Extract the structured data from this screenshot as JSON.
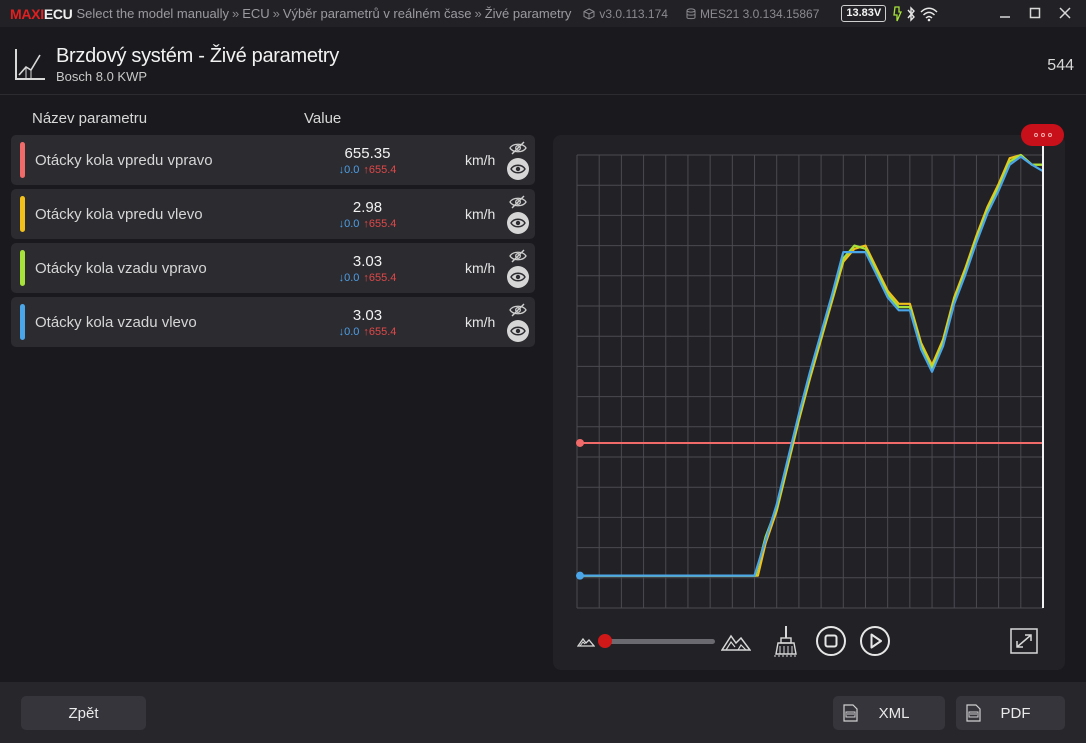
{
  "titlebar": {
    "logo_maxi": "MAXI",
    "logo_ecu": "ECU",
    "breadcrumbs": [
      "Select the model manually",
      "ECU",
      "Výběr parametrů v reálném čase",
      "Živé parametry"
    ],
    "separator": "»",
    "app_version": "v3.0.113.174",
    "device_version": "MES21 3.0.134.15867",
    "voltage": "13.83V",
    "icons": [
      "bolt-icon",
      "bluetooth-icon",
      "wifi-icon"
    ],
    "window_controls": [
      "minimize-icon",
      "maximize-icon",
      "close-icon"
    ]
  },
  "header": {
    "icon": "live-data-chart-icon",
    "title": "Brzdový systém - Živé parametry",
    "subtitle": "Bosch 8.0 KWP",
    "number": "544"
  },
  "params": {
    "col_name": "Název parametru",
    "col_value": "Value",
    "rows": [
      {
        "name": "Otácky kola vpredu vpravo",
        "value": "655.35",
        "min": "↓0.0",
        "max": "↑655.4",
        "unit": "km/h",
        "color": "#f06a6a"
      },
      {
        "name": "Otácky kola vpredu vlevo",
        "value": "2.98",
        "min": "↓0.0",
        "max": "↑655.4",
        "unit": "km/h",
        "color": "#f2c01a"
      },
      {
        "name": "Otácky kola vzadu vpravo",
        "value": "3.03",
        "min": "↓0.0",
        "max": "↑655.4",
        "unit": "km/h",
        "color": "#a6e23a"
      },
      {
        "name": "Otácky kola vzadu vlevo",
        "value": "3.03",
        "min": "↓0.0",
        "max": "↑655.4",
        "unit": "km/h",
        "color": "#4aa6e8"
      }
    ]
  },
  "chart_data": {
    "type": "line",
    "grid": true,
    "ylim": [
      0,
      14
    ],
    "xlim": [
      0,
      42
    ],
    "series": [
      {
        "color": "#f06a6a",
        "x": [
          0,
          42
        ],
        "values": [
          5.1,
          5.1
        ]
      },
      {
        "color": "#f2c01a",
        "x": [
          0,
          16.3,
          17,
          18,
          19,
          20,
          21,
          22,
          23,
          24,
          25,
          26,
          27,
          28,
          29,
          30,
          31,
          32,
          33,
          34,
          35,
          36,
          37,
          38,
          39,
          40,
          41,
          42
        ],
        "values": [
          1,
          1,
          2,
          3,
          4.4,
          5.8,
          7.1,
          8.3,
          9.5,
          10.7,
          11.1,
          11.2,
          10.5,
          9.8,
          9.4,
          9.4,
          8.2,
          7.5,
          8.3,
          9.6,
          10.5,
          11.5,
          12.4,
          13.1,
          13.9,
          14.0,
          13.7,
          13.7
        ]
      },
      {
        "color": "#a6e23a",
        "x": [
          0,
          16.1,
          17,
          18,
          19,
          20,
          21,
          22,
          23,
          24,
          25,
          26,
          27,
          28,
          29,
          30,
          31,
          32,
          33,
          34,
          35,
          36,
          37,
          38,
          39,
          40,
          41,
          42
        ],
        "values": [
          1,
          1,
          2.2,
          3.1,
          4.5,
          5.9,
          7.2,
          8.4,
          9.6,
          10.8,
          11.2,
          11.1,
          10.4,
          9.7,
          9.3,
          9.3,
          8.1,
          7.4,
          8.2,
          9.5,
          10.4,
          11.4,
          12.3,
          13.0,
          13.8,
          14.0,
          13.7,
          13.7
        ]
      },
      {
        "color": "#4aa6e8",
        "x": [
          0,
          16,
          17,
          18,
          19,
          20,
          21,
          22,
          23,
          24,
          25,
          26,
          27,
          28,
          29,
          30,
          31,
          32,
          33,
          34,
          35,
          36,
          37,
          38,
          39,
          40,
          41,
          42
        ],
        "values": [
          1,
          1,
          2.1,
          3.2,
          4.6,
          6.0,
          7.3,
          8.5,
          9.7,
          11.0,
          11.0,
          11.0,
          10.3,
          9.6,
          9.2,
          9.2,
          8.0,
          7.3,
          8.1,
          9.4,
          10.3,
          11.3,
          12.2,
          12.9,
          13.7,
          13.95,
          13.7,
          13.5
        ]
      }
    ]
  },
  "chart_controls": {
    "zoom_out_icon": "mountains-small-icon",
    "zoom_in_icon": "mountains-large-icon",
    "slider_value": 0,
    "icons": [
      "clear-brush-icon",
      "stop-icon",
      "play-icon",
      "fullscreen-icon"
    ]
  },
  "footer": {
    "back_label": "Zpět",
    "xml_label": "XML",
    "pdf_label": "PDF"
  }
}
